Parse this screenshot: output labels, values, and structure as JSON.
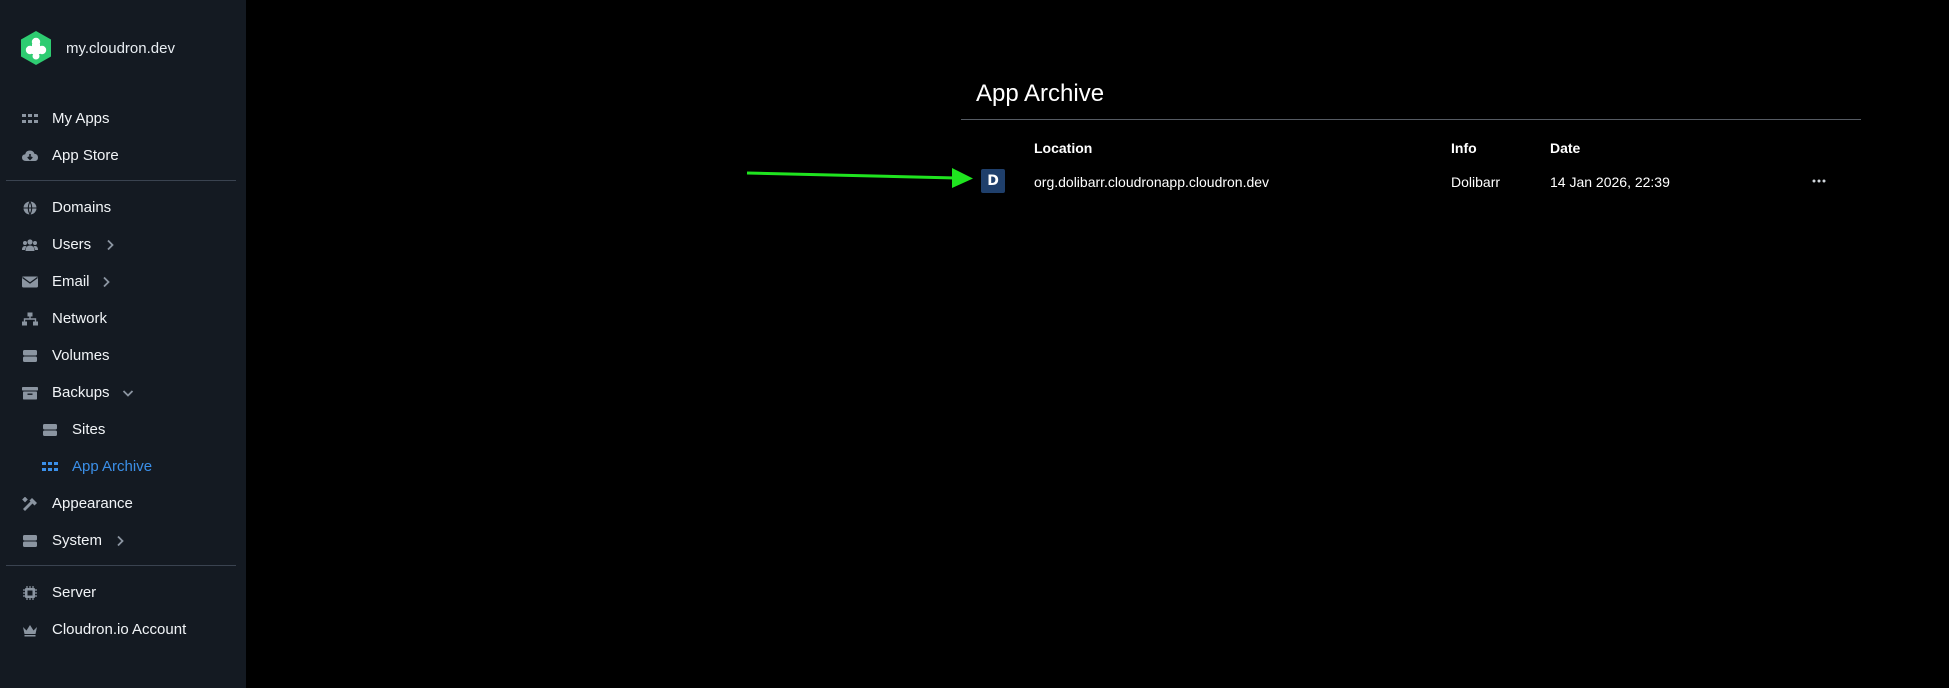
{
  "brand": {
    "name": "my.cloudron.dev",
    "logo_color": "#2ecc71"
  },
  "sidebar": {
    "items": [
      {
        "label": "My Apps",
        "icon": "grid-icon"
      },
      {
        "label": "App Store",
        "icon": "cloud-download-icon"
      },
      {
        "label": "Domains",
        "icon": "globe-icon"
      },
      {
        "label": "Users",
        "icon": "users-icon",
        "expandable": true
      },
      {
        "label": "Email",
        "icon": "envelope-icon",
        "expandable": true
      },
      {
        "label": "Network",
        "icon": "network-icon"
      },
      {
        "label": "Volumes",
        "icon": "database-icon"
      },
      {
        "label": "Backups",
        "icon": "archive-icon",
        "expanded": true
      },
      {
        "label": "Sites",
        "icon": "server-icon",
        "sub": true
      },
      {
        "label": "App Archive",
        "icon": "grid-icon",
        "sub": true,
        "active": true
      },
      {
        "label": "Appearance",
        "icon": "paint-icon"
      },
      {
        "label": "System",
        "icon": "server-icon",
        "expandable": true
      },
      {
        "label": "Server",
        "icon": "chip-icon"
      },
      {
        "label": "Cloudron.io Account",
        "icon": "crown-icon"
      }
    ]
  },
  "main": {
    "title": "App Archive",
    "table": {
      "headers": {
        "location": "Location",
        "info": "Info",
        "date": "Date"
      },
      "rows": [
        {
          "icon_letter": "D",
          "location": "org.dolibarr.cloudronapp.cloudron.dev",
          "info": "Dolibarr",
          "date": "14 Jan 2026, 22:39",
          "actions": "more-icon"
        }
      ]
    }
  },
  "colors": {
    "accent": "#3b8fe8",
    "sidebar_bg": "#141a22",
    "annotation_arrow": "#1fe41f"
  }
}
